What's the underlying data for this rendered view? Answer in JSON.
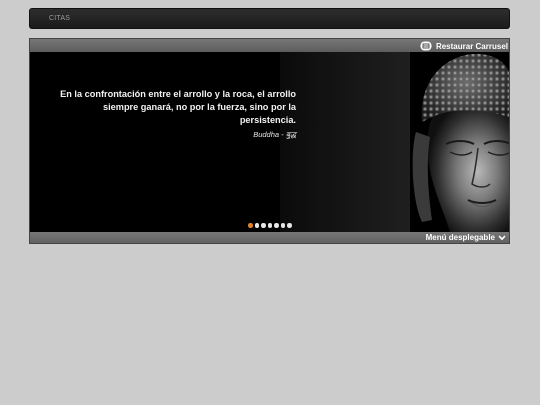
{
  "nav": {
    "items": [
      {
        "label": "CITAS"
      }
    ]
  },
  "carousel": {
    "restore_label": "Restaurar Carrusel",
    "restore_icon": "minimize-box-icon",
    "dropdown_label": "Menú desplegable",
    "dropdown_icon": "chevron-down-icon",
    "slide": {
      "quote": "En la confrontación entre el arrollo y la roca, el arrollo siempre ganará, no por la fuerza, sino por la persistencia.",
      "author": "Buddha - बुद्ध",
      "image": "buddha-statue"
    },
    "slide_count": 7,
    "active_index": 0,
    "colors": {
      "active_dot": "#d9822b",
      "inactive_dot": "#e6e6e6"
    }
  }
}
